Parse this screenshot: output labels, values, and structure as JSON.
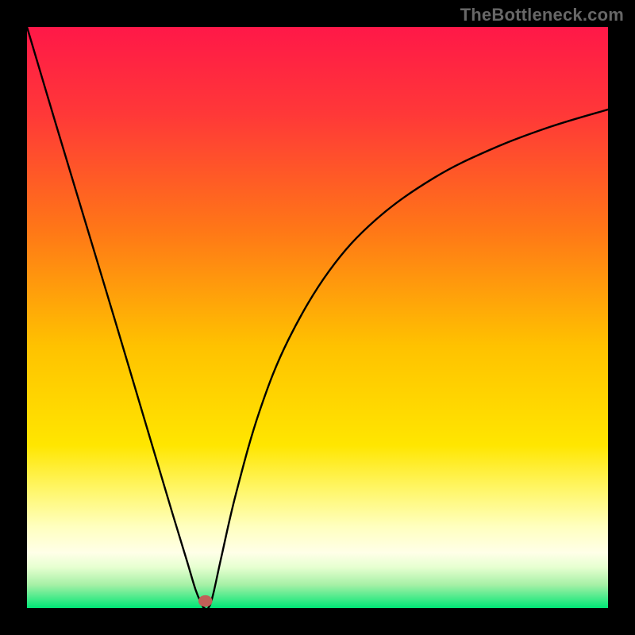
{
  "watermark": "TheBottleneck.com",
  "chart_data": {
    "type": "line",
    "title": "",
    "xlabel": "",
    "ylabel": "",
    "xlim": [
      0,
      1
    ],
    "ylim": [
      0,
      1
    ],
    "background_gradient": {
      "type": "vertical",
      "stops": [
        {
          "pos": 0.0,
          "color": "#ff1848"
        },
        {
          "pos": 0.15,
          "color": "#ff3838"
        },
        {
          "pos": 0.35,
          "color": "#ff7717"
        },
        {
          "pos": 0.55,
          "color": "#ffc200"
        },
        {
          "pos": 0.72,
          "color": "#ffe600"
        },
        {
          "pos": 0.8,
          "color": "#fff76e"
        },
        {
          "pos": 0.86,
          "color": "#ffffbf"
        },
        {
          "pos": 0.905,
          "color": "#ffffe8"
        },
        {
          "pos": 0.93,
          "color": "#e6ffd0"
        },
        {
          "pos": 0.96,
          "color": "#a6f0a6"
        },
        {
          "pos": 1.0,
          "color": "#00e676"
        }
      ]
    },
    "series": [
      {
        "name": "bottleneck-curve",
        "color": "#000000",
        "x": [
          0.0,
          0.05,
          0.1,
          0.15,
          0.2,
          0.25,
          0.275,
          0.29,
          0.3,
          0.305,
          0.312,
          0.32,
          0.335,
          0.36,
          0.4,
          0.45,
          0.52,
          0.6,
          0.7,
          0.8,
          0.9,
          1.0
        ],
        "y": [
          1.0,
          0.832,
          0.666,
          0.5,
          0.332,
          0.164,
          0.082,
          0.032,
          0.008,
          0.0,
          0.0,
          0.022,
          0.09,
          0.198,
          0.338,
          0.462,
          0.58,
          0.668,
          0.74,
          0.79,
          0.828,
          0.858
        ]
      }
    ],
    "marker": {
      "x": 0.307,
      "y": 0.012,
      "rx": 0.012,
      "ry": 0.01,
      "fill": "#c06058"
    }
  }
}
